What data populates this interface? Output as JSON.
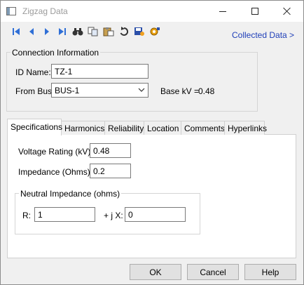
{
  "window": {
    "title": "Zigzag Data"
  },
  "toolbar": {
    "icons": [
      "first-record-icon",
      "previous-record-icon",
      "next-record-icon",
      "last-record-icon",
      "find-icon",
      "copy-icon",
      "paste-icon",
      "undo-icon",
      "save-library-icon",
      "settings-icon"
    ],
    "collected_data_link": "Collected Data >"
  },
  "connection": {
    "legend": "Connection Information",
    "id_label": "ID Name:",
    "id_value": "TZ-1",
    "from_bus_label": "From Bus:",
    "from_bus_value": "BUS-1",
    "base_kv_label": "Base kV =",
    "base_kv_value": "0.48"
  },
  "tabs": [
    "Specifications",
    "Harmonics",
    "Reliability",
    "Location",
    "Comments",
    "Hyperlinks"
  ],
  "specifications": {
    "voltage_label": "Voltage Rating (kV):",
    "voltage_value": "0.48",
    "impedance_label": "Impedance (Ohms):",
    "impedance_value": "0.2",
    "neutral": {
      "legend": "Neutral Impedance (ohms)",
      "r_label": "R:",
      "r_value": "1",
      "x_label": "+ j X:",
      "x_value": "0"
    }
  },
  "buttons": {
    "ok": "OK",
    "cancel": "Cancel",
    "help": "Help"
  },
  "colors": {
    "link": "#1f3fb8",
    "nav_icon": "#2f6fd6"
  }
}
